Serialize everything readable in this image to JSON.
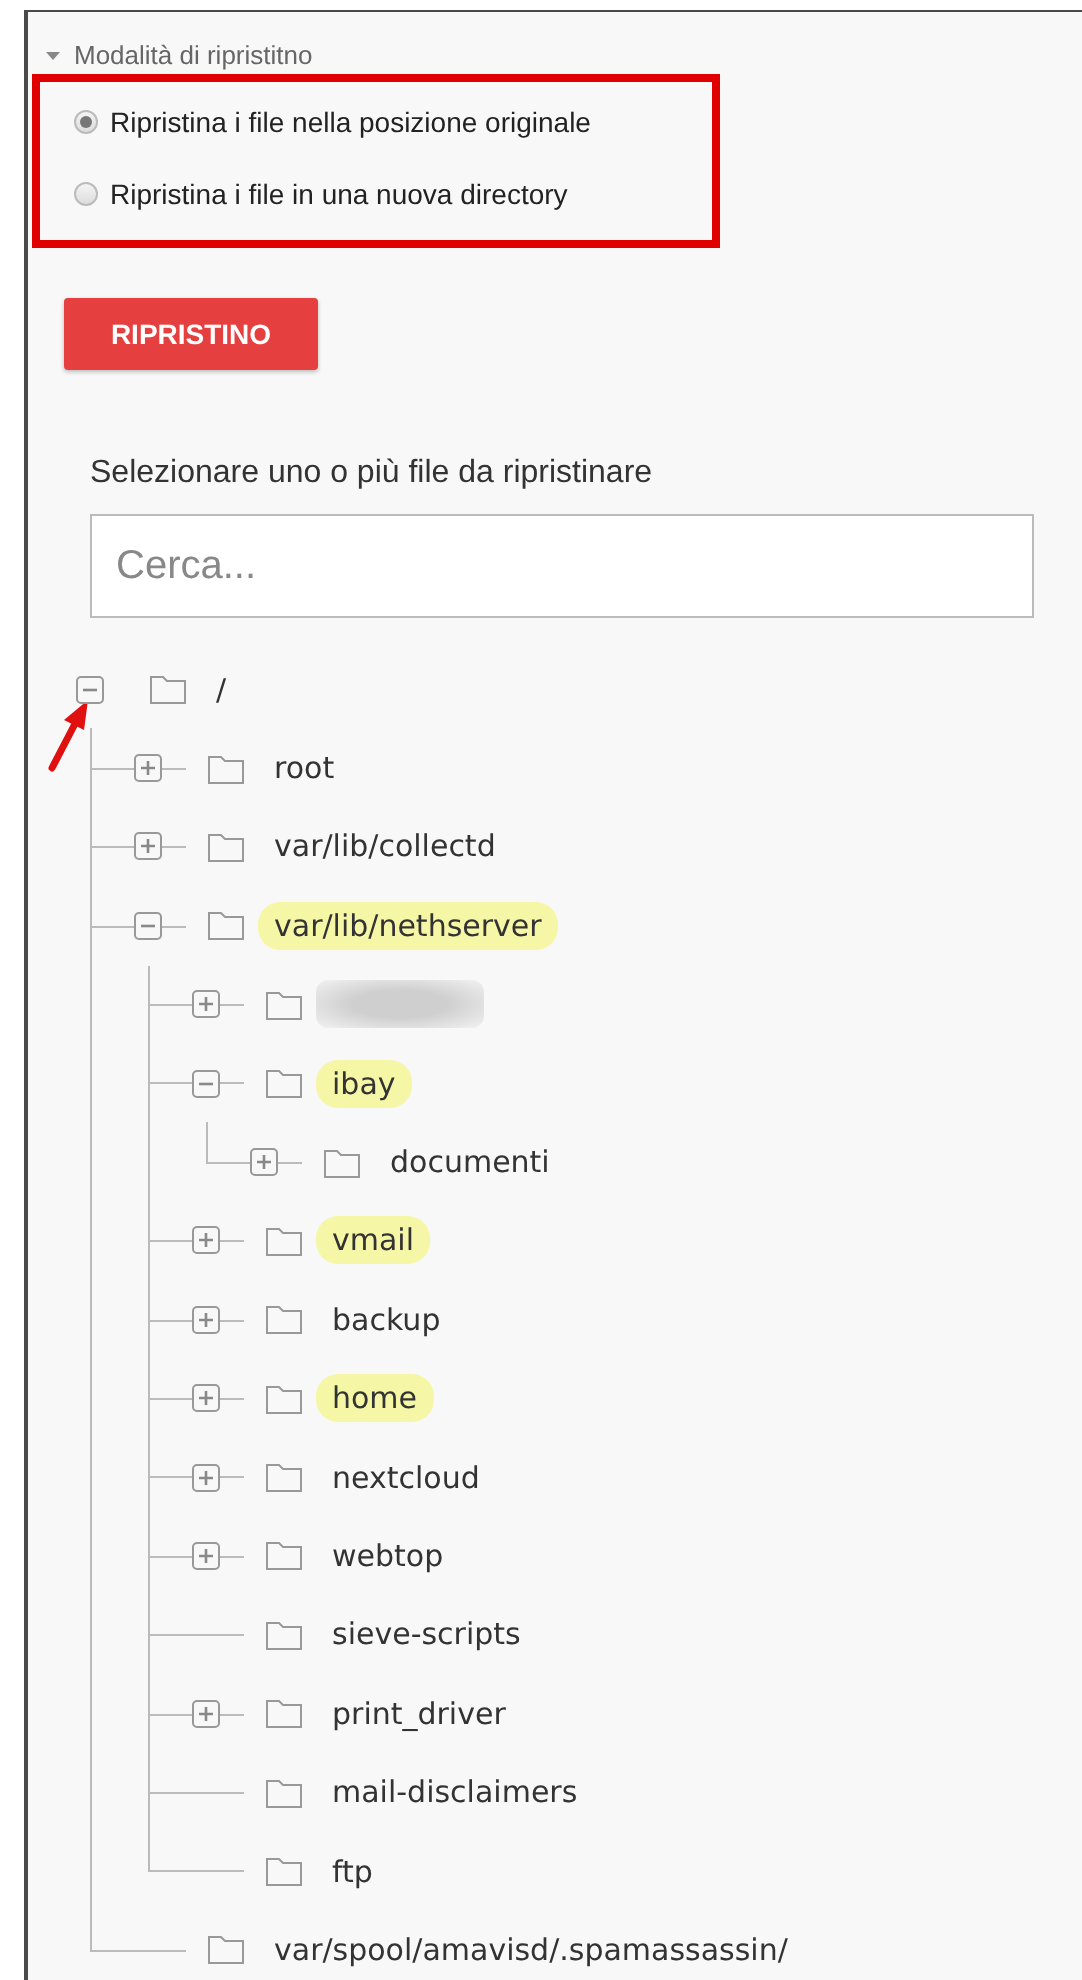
{
  "mode": {
    "title": "Modalità di ripristitno",
    "expanded": true,
    "annotated": true,
    "options": [
      {
        "label": "Ripristina i file nella posizione originale",
        "selected": true
      },
      {
        "label": "Ripristina i file in una nuova directory",
        "selected": false
      }
    ]
  },
  "restore_button": "RIPRISTINO",
  "file_selection": {
    "label": "Selezionare uno o più file da ripristinare",
    "search": {
      "placeholder": "Cerca..."
    }
  },
  "pointer_arrow": true,
  "tree": [
    {
      "kind": "folder",
      "label": "/",
      "expandable": true,
      "expanded": true,
      "highlighted": false,
      "children": [
        {
          "kind": "folder",
          "label": "root",
          "expandable": true,
          "expanded": false,
          "highlighted": false
        },
        {
          "kind": "folder",
          "label": "var/lib/collectd",
          "expandable": true,
          "expanded": false,
          "highlighted": false
        },
        {
          "kind": "folder",
          "label": "var/lib/nethserver",
          "expandable": true,
          "expanded": true,
          "highlighted": true,
          "children": [
            {
              "kind": "redacted",
              "expandable": true,
              "expanded": false
            },
            {
              "kind": "folder",
              "label": "ibay",
              "expandable": true,
              "expanded": true,
              "highlighted": true,
              "children": [
                {
                  "kind": "folder",
                  "label": "documenti",
                  "expandable": true,
                  "expanded": false,
                  "highlighted": false
                }
              ]
            },
            {
              "kind": "folder",
              "label": "vmail",
              "expandable": true,
              "expanded": false,
              "highlighted": true
            },
            {
              "kind": "folder",
              "label": "backup",
              "expandable": true,
              "expanded": false,
              "highlighted": false
            },
            {
              "kind": "folder",
              "label": "home",
              "expandable": true,
              "expanded": false,
              "highlighted": true
            },
            {
              "kind": "folder",
              "label": "nextcloud",
              "expandable": true,
              "expanded": false,
              "highlighted": false
            },
            {
              "kind": "folder",
              "label": "webtop",
              "expandable": true,
              "expanded": false,
              "highlighted": false
            },
            {
              "kind": "folder",
              "label": "sieve-scripts",
              "expandable": false,
              "highlighted": false
            },
            {
              "kind": "folder",
              "label": "print_driver",
              "expandable": true,
              "expanded": false,
              "highlighted": false
            },
            {
              "kind": "folder",
              "label": "mail-disclaimers",
              "expandable": false,
              "highlighted": false
            },
            {
              "kind": "folder",
              "label": "ftp",
              "expandable": false,
              "highlighted": false
            }
          ]
        },
        {
          "kind": "folder",
          "label": "var/spool/amavisd/.spamassassin/",
          "expandable": false,
          "highlighted": false
        }
      ]
    }
  ]
}
